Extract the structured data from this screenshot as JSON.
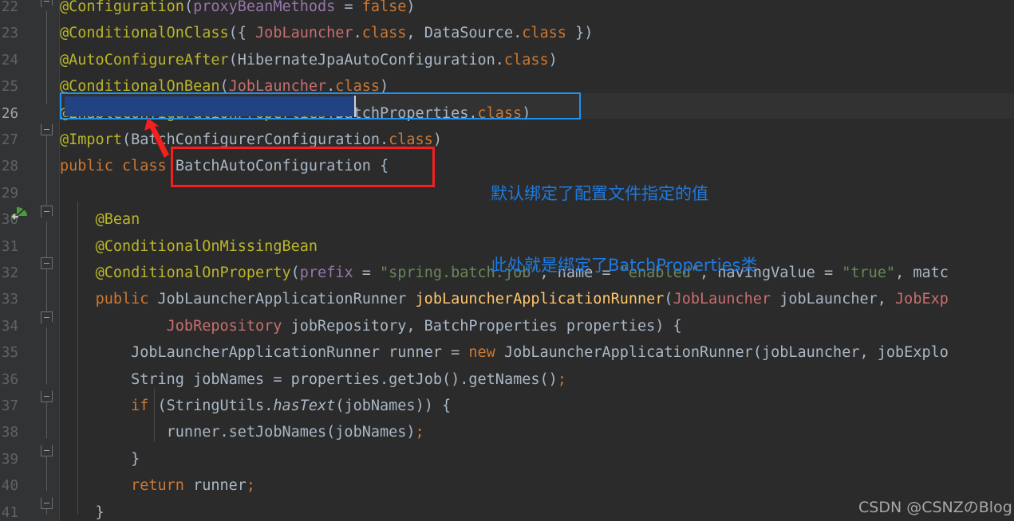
{
  "editor": {
    "background": "#2b2b2b",
    "gutter_background": "#313335",
    "font_size_px": 18.5
  },
  "gutter": {
    "line_numbers": [
      "22",
      "23",
      "24",
      "25",
      "26",
      "27",
      "28",
      "29",
      "30",
      "31",
      "32",
      "33",
      "34",
      "35",
      "36",
      "37",
      "38",
      "39",
      "40",
      "41"
    ],
    "current_line_number": "26",
    "run_icon_name": "run-gutter-icon",
    "fold_icon_name": "fold-minus-icon"
  },
  "code_lines": [
    {
      "n": "22",
      "tokens": [
        {
          "t": "@Configuration",
          "c": "ann"
        },
        {
          "t": "(",
          "c": "punc"
        },
        {
          "t": "proxyBeanMethods",
          "c": "field"
        },
        {
          "t": " = ",
          "c": "punc"
        },
        {
          "t": "false",
          "c": "kw"
        },
        {
          "t": ")",
          "c": "punc"
        }
      ]
    },
    {
      "n": "23",
      "tokens": [
        {
          "t": "@ConditionalOnClass",
          "c": "ann"
        },
        {
          "t": "({ ",
          "c": "punc"
        },
        {
          "t": "JobLauncher",
          "c": "cls"
        },
        {
          "t": ".",
          "c": "punc"
        },
        {
          "t": "class",
          "c": "kw"
        },
        {
          "t": ", ",
          "c": "punc"
        },
        {
          "t": "DataSource",
          "c": "ident"
        },
        {
          "t": ".",
          "c": "punc"
        },
        {
          "t": "class",
          "c": "kw"
        },
        {
          "t": " })",
          "c": "punc"
        }
      ]
    },
    {
      "n": "24",
      "tokens": [
        {
          "t": "@AutoConfigureAfter",
          "c": "ann"
        },
        {
          "t": "(",
          "c": "punc"
        },
        {
          "t": "HibernateJpaAutoConfiguration",
          "c": "ident"
        },
        {
          "t": ".",
          "c": "punc"
        },
        {
          "t": "class",
          "c": "kw"
        },
        {
          "t": ")",
          "c": "punc"
        }
      ]
    },
    {
      "n": "25",
      "tokens": [
        {
          "t": "@ConditionalOnBean",
          "c": "ann"
        },
        {
          "t": "(",
          "c": "punc"
        },
        {
          "t": "JobLauncher",
          "c": "cls"
        },
        {
          "t": ".",
          "c": "punc"
        },
        {
          "t": "class",
          "c": "kw"
        },
        {
          "t": ")",
          "c": "punc"
        }
      ]
    },
    {
      "n": "26",
      "selected": true,
      "tokens": [
        {
          "t": "@EnableConfigurationProperties",
          "c": "ann"
        },
        {
          "t": "(",
          "c": "punc"
        },
        {
          "t": "BatchProperties",
          "c": "ident"
        },
        {
          "t": ".",
          "c": "punc"
        },
        {
          "t": "class",
          "c": "kw"
        },
        {
          "t": ")",
          "c": "punc"
        }
      ]
    },
    {
      "n": "27",
      "tokens": [
        {
          "t": "@Import",
          "c": "ann"
        },
        {
          "t": "(",
          "c": "punc"
        },
        {
          "t": "BatchConfigurerConfiguration",
          "c": "ident"
        },
        {
          "t": ".",
          "c": "punc"
        },
        {
          "t": "class",
          "c": "kw"
        },
        {
          "t": ")",
          "c": "punc"
        }
      ]
    },
    {
      "n": "28",
      "tokens": [
        {
          "t": "public",
          "c": "kw"
        },
        {
          "t": " ",
          "c": "punc"
        },
        {
          "t": "class",
          "c": "kw"
        },
        {
          "t": " ",
          "c": "punc"
        },
        {
          "t": "BatchAutoConfiguration",
          "c": "ident"
        },
        {
          "t": " {",
          "c": "punc"
        }
      ]
    },
    {
      "n": "29",
      "tokens": []
    },
    {
      "n": "30",
      "tokens": [
        {
          "t": "    ",
          "c": "punc"
        },
        {
          "t": "@Bean",
          "c": "ann"
        }
      ]
    },
    {
      "n": "31",
      "tokens": [
        {
          "t": "    ",
          "c": "punc"
        },
        {
          "t": "@ConditionalOnMissingBean",
          "c": "ann"
        }
      ]
    },
    {
      "n": "32",
      "tokens": [
        {
          "t": "    ",
          "c": "punc"
        },
        {
          "t": "@ConditionalOnProperty",
          "c": "ann"
        },
        {
          "t": "(",
          "c": "punc"
        },
        {
          "t": "prefix",
          "c": "field"
        },
        {
          "t": " = ",
          "c": "punc"
        },
        {
          "t": "\"spring.batch.job\"",
          "c": "str"
        },
        {
          "t": ", ",
          "c": "punc"
        },
        {
          "t": "name",
          "c": "ident"
        },
        {
          "t": " = ",
          "c": "punc"
        },
        {
          "t": "\"enabled\"",
          "c": "str"
        },
        {
          "t": ", ",
          "c": "punc"
        },
        {
          "t": "havingValue",
          "c": "ident"
        },
        {
          "t": " = ",
          "c": "punc"
        },
        {
          "t": "\"true\"",
          "c": "str"
        },
        {
          "t": ", ",
          "c": "punc"
        },
        {
          "t": "matc",
          "c": "ident"
        }
      ]
    },
    {
      "n": "33",
      "tokens": [
        {
          "t": "    ",
          "c": "punc"
        },
        {
          "t": "public",
          "c": "kw"
        },
        {
          "t": " ",
          "c": "punc"
        },
        {
          "t": "JobLauncherApplicationRunner",
          "c": "ident"
        },
        {
          "t": " ",
          "c": "punc"
        },
        {
          "t": "jobLauncherApplicationRunner",
          "c": "meth"
        },
        {
          "t": "(",
          "c": "punc"
        },
        {
          "t": "JobLauncher",
          "c": "cls"
        },
        {
          "t": " ",
          "c": "punc"
        },
        {
          "t": "jobLauncher",
          "c": "ident"
        },
        {
          "t": ", ",
          "c": "punc"
        },
        {
          "t": "JobExp",
          "c": "cls"
        }
      ]
    },
    {
      "n": "34",
      "tokens": [
        {
          "t": "            ",
          "c": "punc"
        },
        {
          "t": "JobRepository",
          "c": "cls"
        },
        {
          "t": " ",
          "c": "punc"
        },
        {
          "t": "jobRepository",
          "c": "ident"
        },
        {
          "t": ", ",
          "c": "punc"
        },
        {
          "t": "BatchProperties",
          "c": "ident"
        },
        {
          "t": " ",
          "c": "punc"
        },
        {
          "t": "properties",
          "c": "ident"
        },
        {
          "t": ") {",
          "c": "punc"
        }
      ]
    },
    {
      "n": "35",
      "tokens": [
        {
          "t": "        ",
          "c": "punc"
        },
        {
          "t": "JobLauncherApplicationRunner",
          "c": "ident"
        },
        {
          "t": " ",
          "c": "punc"
        },
        {
          "t": "runner",
          "c": "ident"
        },
        {
          "t": " = ",
          "c": "punc"
        },
        {
          "t": "new",
          "c": "kw"
        },
        {
          "t": " ",
          "c": "punc"
        },
        {
          "t": "JobLauncherApplicationRunner",
          "c": "ident"
        },
        {
          "t": "(",
          "c": "punc"
        },
        {
          "t": "jobLauncher",
          "c": "ident"
        },
        {
          "t": ", ",
          "c": "punc"
        },
        {
          "t": "jobExplo",
          "c": "ident"
        }
      ]
    },
    {
      "n": "36",
      "tokens": [
        {
          "t": "        ",
          "c": "punc"
        },
        {
          "t": "String",
          "c": "ident"
        },
        {
          "t": " ",
          "c": "punc"
        },
        {
          "t": "jobNames",
          "c": "ident"
        },
        {
          "t": " = ",
          "c": "punc"
        },
        {
          "t": "properties",
          "c": "ident"
        },
        {
          "t": ".",
          "c": "punc"
        },
        {
          "t": "getJob",
          "c": "ident"
        },
        {
          "t": "().",
          "c": "punc"
        },
        {
          "t": "getNames",
          "c": "ident"
        },
        {
          "t": "()",
          "c": "punc"
        },
        {
          "t": ";",
          "c": "kw"
        }
      ]
    },
    {
      "n": "37",
      "tokens": [
        {
          "t": "        ",
          "c": "punc"
        },
        {
          "t": "if",
          "c": "kw"
        },
        {
          "t": " (",
          "c": "punc"
        },
        {
          "t": "StringUtils",
          "c": "ident"
        },
        {
          "t": ".",
          "c": "punc"
        },
        {
          "t": "hasText",
          "c": "ident",
          "italic": true
        },
        {
          "t": "(",
          "c": "punc"
        },
        {
          "t": "jobNames",
          "c": "ident"
        },
        {
          "t": ")) {",
          "c": "punc"
        }
      ]
    },
    {
      "n": "38",
      "tokens": [
        {
          "t": "            ",
          "c": "punc"
        },
        {
          "t": "runner",
          "c": "ident"
        },
        {
          "t": ".",
          "c": "punc"
        },
        {
          "t": "setJobNames",
          "c": "ident"
        },
        {
          "t": "(",
          "c": "punc"
        },
        {
          "t": "jobNames",
          "c": "ident"
        },
        {
          "t": ")",
          "c": "punc"
        },
        {
          "t": ";",
          "c": "kw"
        }
      ]
    },
    {
      "n": "39",
      "tokens": [
        {
          "t": "        }",
          "c": "punc"
        }
      ]
    },
    {
      "n": "40",
      "tokens": [
        {
          "t": "        ",
          "c": "punc"
        },
        {
          "t": "return",
          "c": "kw"
        },
        {
          "t": " ",
          "c": "punc"
        },
        {
          "t": "runner",
          "c": "ident"
        },
        {
          "t": ";",
          "c": "kw"
        }
      ]
    },
    {
      "n": "41",
      "tokens": [
        {
          "t": "    }",
          "c": "punc"
        }
      ]
    }
  ],
  "annotations": {
    "selection": {
      "line": "26",
      "selected_text": "@EnableConfigurationProperties",
      "border_color": "#1e92f0",
      "selection_color": "#214283"
    },
    "red_box": {
      "target_text": "BatchAutoConfiguration {",
      "color": "#f41f1f"
    },
    "red_arrow": {
      "color": "#f41f1f",
      "name": "red-arrow-annotation"
    },
    "chinese_note": {
      "line1": "默认绑定了配置文件指定的值",
      "line2": "此处就是绑定了BatchProperties类",
      "color": "#1e7ae0"
    }
  },
  "watermark": {
    "text": "CSDN @CSNZのBlog"
  }
}
